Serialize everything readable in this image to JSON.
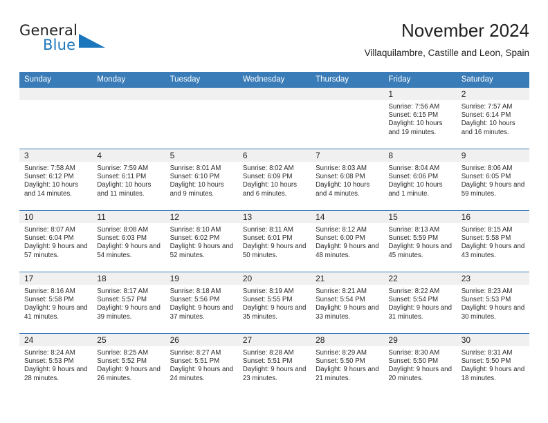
{
  "brand": {
    "name_part1": "General",
    "name_part2": "Blue",
    "triangle_icon": "triangle-icon",
    "accent_color": "#1b76bc"
  },
  "header": {
    "title": "November 2024",
    "subtitle": "Villaquilambre, Castille and Leon, Spain"
  },
  "colors": {
    "header_blue": "#3a7cb8",
    "date_band_gray": "#f0f0f0",
    "text": "#2a2a2a"
  },
  "weekday_headers": [
    "Sunday",
    "Monday",
    "Tuesday",
    "Wednesday",
    "Thursday",
    "Friday",
    "Saturday"
  ],
  "weeks": [
    {
      "days": [
        {
          "date": "",
          "blank": true
        },
        {
          "date": "",
          "blank": true
        },
        {
          "date": "",
          "blank": true
        },
        {
          "date": "",
          "blank": true
        },
        {
          "date": "",
          "blank": true
        },
        {
          "date": "1",
          "sunrise": "Sunrise: 7:56 AM",
          "sunset": "Sunset: 6:15 PM",
          "daylight": "Daylight: 10 hours and 19 minutes."
        },
        {
          "date": "2",
          "sunrise": "Sunrise: 7:57 AM",
          "sunset": "Sunset: 6:14 PM",
          "daylight": "Daylight: 10 hours and 16 minutes."
        }
      ]
    },
    {
      "days": [
        {
          "date": "3",
          "sunrise": "Sunrise: 7:58 AM",
          "sunset": "Sunset: 6:12 PM",
          "daylight": "Daylight: 10 hours and 14 minutes."
        },
        {
          "date": "4",
          "sunrise": "Sunrise: 7:59 AM",
          "sunset": "Sunset: 6:11 PM",
          "daylight": "Daylight: 10 hours and 11 minutes."
        },
        {
          "date": "5",
          "sunrise": "Sunrise: 8:01 AM",
          "sunset": "Sunset: 6:10 PM",
          "daylight": "Daylight: 10 hours and 9 minutes."
        },
        {
          "date": "6",
          "sunrise": "Sunrise: 8:02 AM",
          "sunset": "Sunset: 6:09 PM",
          "daylight": "Daylight: 10 hours and 6 minutes."
        },
        {
          "date": "7",
          "sunrise": "Sunrise: 8:03 AM",
          "sunset": "Sunset: 6:08 PM",
          "daylight": "Daylight: 10 hours and 4 minutes."
        },
        {
          "date": "8",
          "sunrise": "Sunrise: 8:04 AM",
          "sunset": "Sunset: 6:06 PM",
          "daylight": "Daylight: 10 hours and 1 minute."
        },
        {
          "date": "9",
          "sunrise": "Sunrise: 8:06 AM",
          "sunset": "Sunset: 6:05 PM",
          "daylight": "Daylight: 9 hours and 59 minutes."
        }
      ]
    },
    {
      "days": [
        {
          "date": "10",
          "sunrise": "Sunrise: 8:07 AM",
          "sunset": "Sunset: 6:04 PM",
          "daylight": "Daylight: 9 hours and 57 minutes."
        },
        {
          "date": "11",
          "sunrise": "Sunrise: 8:08 AM",
          "sunset": "Sunset: 6:03 PM",
          "daylight": "Daylight: 9 hours and 54 minutes."
        },
        {
          "date": "12",
          "sunrise": "Sunrise: 8:10 AM",
          "sunset": "Sunset: 6:02 PM",
          "daylight": "Daylight: 9 hours and 52 minutes."
        },
        {
          "date": "13",
          "sunrise": "Sunrise: 8:11 AM",
          "sunset": "Sunset: 6:01 PM",
          "daylight": "Daylight: 9 hours and 50 minutes."
        },
        {
          "date": "14",
          "sunrise": "Sunrise: 8:12 AM",
          "sunset": "Sunset: 6:00 PM",
          "daylight": "Daylight: 9 hours and 48 minutes."
        },
        {
          "date": "15",
          "sunrise": "Sunrise: 8:13 AM",
          "sunset": "Sunset: 5:59 PM",
          "daylight": "Daylight: 9 hours and 45 minutes."
        },
        {
          "date": "16",
          "sunrise": "Sunrise: 8:15 AM",
          "sunset": "Sunset: 5:58 PM",
          "daylight": "Daylight: 9 hours and 43 minutes."
        }
      ]
    },
    {
      "days": [
        {
          "date": "17",
          "sunrise": "Sunrise: 8:16 AM",
          "sunset": "Sunset: 5:58 PM",
          "daylight": "Daylight: 9 hours and 41 minutes."
        },
        {
          "date": "18",
          "sunrise": "Sunrise: 8:17 AM",
          "sunset": "Sunset: 5:57 PM",
          "daylight": "Daylight: 9 hours and 39 minutes."
        },
        {
          "date": "19",
          "sunrise": "Sunrise: 8:18 AM",
          "sunset": "Sunset: 5:56 PM",
          "daylight": "Daylight: 9 hours and 37 minutes."
        },
        {
          "date": "20",
          "sunrise": "Sunrise: 8:19 AM",
          "sunset": "Sunset: 5:55 PM",
          "daylight": "Daylight: 9 hours and 35 minutes."
        },
        {
          "date": "21",
          "sunrise": "Sunrise: 8:21 AM",
          "sunset": "Sunset: 5:54 PM",
          "daylight": "Daylight: 9 hours and 33 minutes."
        },
        {
          "date": "22",
          "sunrise": "Sunrise: 8:22 AM",
          "sunset": "Sunset: 5:54 PM",
          "daylight": "Daylight: 9 hours and 31 minutes."
        },
        {
          "date": "23",
          "sunrise": "Sunrise: 8:23 AM",
          "sunset": "Sunset: 5:53 PM",
          "daylight": "Daylight: 9 hours and 30 minutes."
        }
      ]
    },
    {
      "days": [
        {
          "date": "24",
          "sunrise": "Sunrise: 8:24 AM",
          "sunset": "Sunset: 5:53 PM",
          "daylight": "Daylight: 9 hours and 28 minutes."
        },
        {
          "date": "25",
          "sunrise": "Sunrise: 8:25 AM",
          "sunset": "Sunset: 5:52 PM",
          "daylight": "Daylight: 9 hours and 26 minutes."
        },
        {
          "date": "26",
          "sunrise": "Sunrise: 8:27 AM",
          "sunset": "Sunset: 5:51 PM",
          "daylight": "Daylight: 9 hours and 24 minutes."
        },
        {
          "date": "27",
          "sunrise": "Sunrise: 8:28 AM",
          "sunset": "Sunset: 5:51 PM",
          "daylight": "Daylight: 9 hours and 23 minutes."
        },
        {
          "date": "28",
          "sunrise": "Sunrise: 8:29 AM",
          "sunset": "Sunset: 5:50 PM",
          "daylight": "Daylight: 9 hours and 21 minutes."
        },
        {
          "date": "29",
          "sunrise": "Sunrise: 8:30 AM",
          "sunset": "Sunset: 5:50 PM",
          "daylight": "Daylight: 9 hours and 20 minutes."
        },
        {
          "date": "30",
          "sunrise": "Sunrise: 8:31 AM",
          "sunset": "Sunset: 5:50 PM",
          "daylight": "Daylight: 9 hours and 18 minutes."
        }
      ]
    }
  ]
}
